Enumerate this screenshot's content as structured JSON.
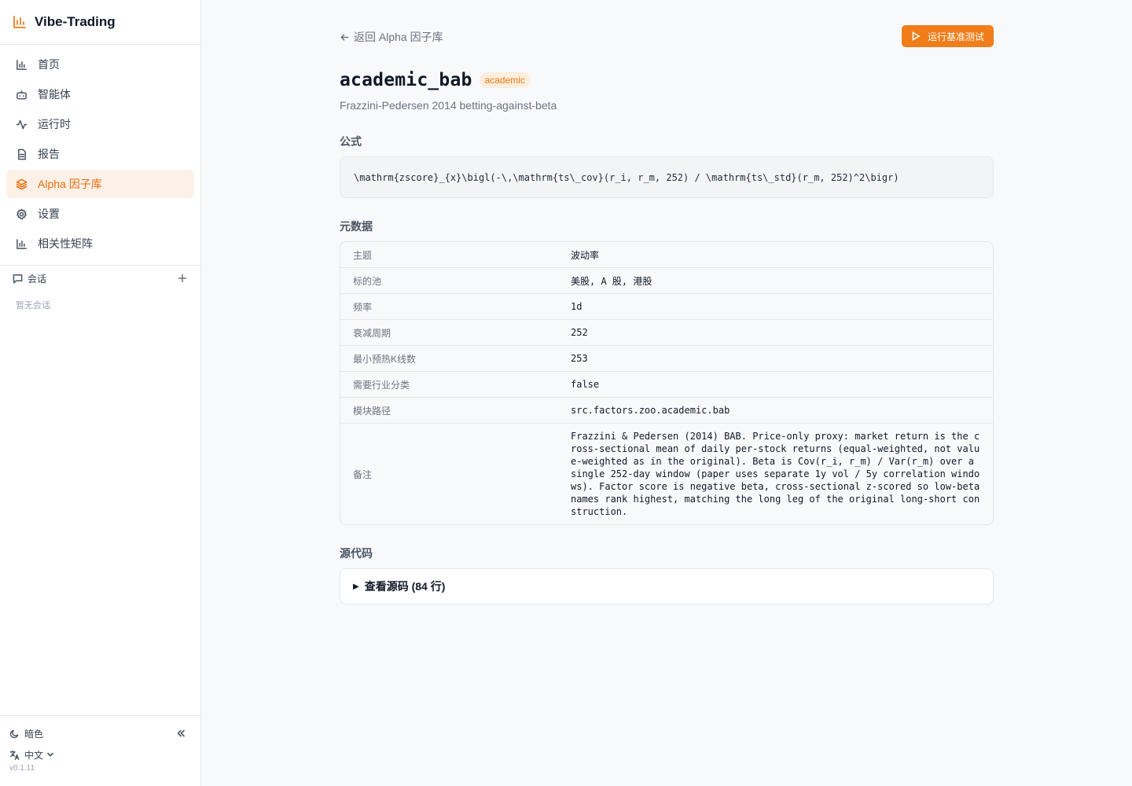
{
  "app": {
    "name": "Vibe-Trading",
    "version": "v0.1.11"
  },
  "sidebar": {
    "items": [
      {
        "label": "首页",
        "icon": "bar-chart-icon"
      },
      {
        "label": "智能体",
        "icon": "bot-icon"
      },
      {
        "label": "运行时",
        "icon": "activity-icon"
      },
      {
        "label": "报告",
        "icon": "document-icon"
      },
      {
        "label": "Alpha 因子库",
        "icon": "layers-icon",
        "active": true
      },
      {
        "label": "设置",
        "icon": "gear-icon"
      },
      {
        "label": "相关性矩阵",
        "icon": "bar-chart-icon"
      }
    ],
    "sessions_label": "会话",
    "sessions_empty": "暂无会话",
    "theme_label": "暗色",
    "language_label": "中文"
  },
  "header": {
    "back_label": "返回 Alpha 因子库",
    "run_label": "运行基准测试"
  },
  "factor": {
    "name": "academic_bab",
    "badge": "academic",
    "subtitle": "Frazzini-Pedersen 2014 betting-against-beta"
  },
  "sections": {
    "formula": "公式",
    "metadata": "元数据",
    "source": "源代码"
  },
  "formula": "\\mathrm{zscore}_{x}\\bigl(-\\,\\mathrm{ts\\_cov}(r_i, r_m, 252) / \\mathrm{ts\\_std}(r_m, 252)^2\\bigr)",
  "metadata": [
    {
      "key": "主题",
      "value": "波动率"
    },
    {
      "key": "标的池",
      "value": "美股, A 股, 港股"
    },
    {
      "key": "频率",
      "value": "1d"
    },
    {
      "key": "衰减周期",
      "value": "252"
    },
    {
      "key": "最小预热K线数",
      "value": "253"
    },
    {
      "key": "需要行业分类",
      "value": "false"
    },
    {
      "key": "模块路径",
      "value": "src.factors.zoo.academic.bab"
    },
    {
      "key": "备注",
      "value": "Frazzini & Pedersen (2014) BAB. Price-only proxy: market return is the cross-sectional mean of daily per-stock returns (equal-weighted, not value-weighted as in the original). Beta is Cov(r_i, r_m) / Var(r_m) over a single 252-day window (paper uses separate 1y vol / 5y correlation windows). Factor score is negative beta, cross-sectional z-scored so low-beta names rank highest, matching the long leg of the original long-short construction."
    }
  ],
  "source": {
    "toggle_label": "查看源码 (84 行)"
  },
  "colors": {
    "accent": "#f07d1a",
    "active_bg": "#fdf1e7",
    "badge_bg": "#fdeedd"
  }
}
